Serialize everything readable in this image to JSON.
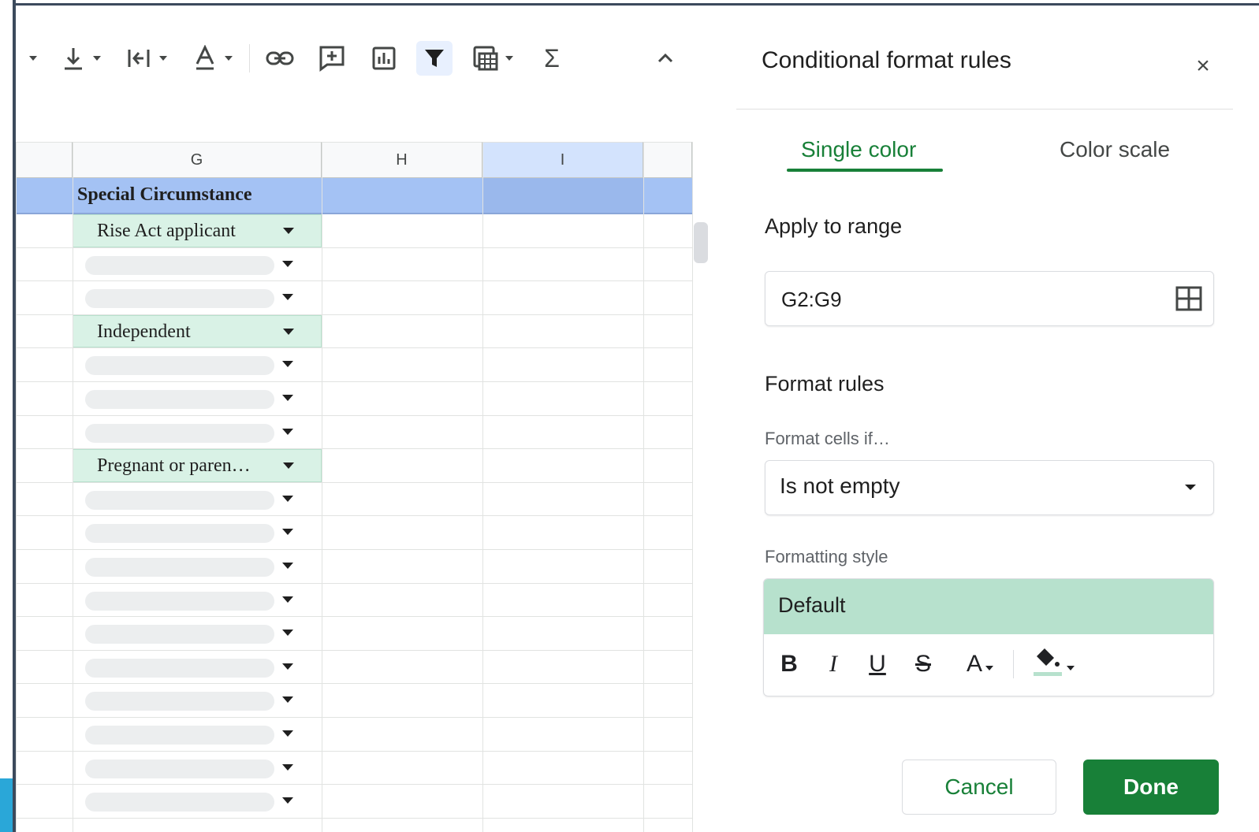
{
  "toolbar": {
    "items": [
      "align-bottom-icon",
      "text-wrap-icon",
      "text-rotate-icon",
      "insert-link-icon",
      "insert-comment-icon",
      "insert-chart-icon",
      "filter-icon",
      "filter-views-icon",
      "functions-icon",
      "collapse-icon"
    ]
  },
  "grid": {
    "columns": [
      {
        "label": "G",
        "selected": false
      },
      {
        "label": "H",
        "selected": false
      },
      {
        "label": "I",
        "selected": true
      }
    ],
    "header_cell": "Special Circumstance",
    "rows": [
      {
        "value": "Rise Act applicant",
        "filled": true
      },
      {
        "value": "",
        "filled": false
      },
      {
        "value": "",
        "filled": false
      },
      {
        "value": "Independent",
        "filled": true
      },
      {
        "value": "",
        "filled": false
      },
      {
        "value": "",
        "filled": false
      },
      {
        "value": "",
        "filled": false
      },
      {
        "value": "Pregnant or paren…",
        "filled": true
      },
      {
        "value": "",
        "filled": false
      },
      {
        "value": "",
        "filled": false
      },
      {
        "value": "",
        "filled": false
      },
      {
        "value": "",
        "filled": false
      },
      {
        "value": "",
        "filled": false
      },
      {
        "value": "",
        "filled": false
      },
      {
        "value": "",
        "filled": false
      },
      {
        "value": "",
        "filled": false
      },
      {
        "value": "",
        "filled": false
      },
      {
        "value": "",
        "filled": false
      }
    ]
  },
  "panel": {
    "title": "Conditional format rules",
    "close_label": "×",
    "tabs": [
      {
        "label": "Single color",
        "active": true
      },
      {
        "label": "Color scale",
        "active": false
      }
    ],
    "apply_to_range_label": "Apply to range",
    "range_value": "G2:G9",
    "format_rules_label": "Format rules",
    "format_cells_if_label": "Format cells if…",
    "condition_value": "Is not empty",
    "formatting_style_label": "Formatting style",
    "style_preview": "Default",
    "format_buttons": {
      "bold": "B",
      "italic": "I",
      "underline": "U",
      "strikethrough": "S",
      "text_color": "A"
    },
    "cancel_label": "Cancel",
    "done_label": "Done"
  },
  "colors": {
    "accent_green": "#188038",
    "preview_fill": "#b7e1cd",
    "header_blue": "#a4c2f4",
    "chip_green": "#d9f2e6"
  }
}
